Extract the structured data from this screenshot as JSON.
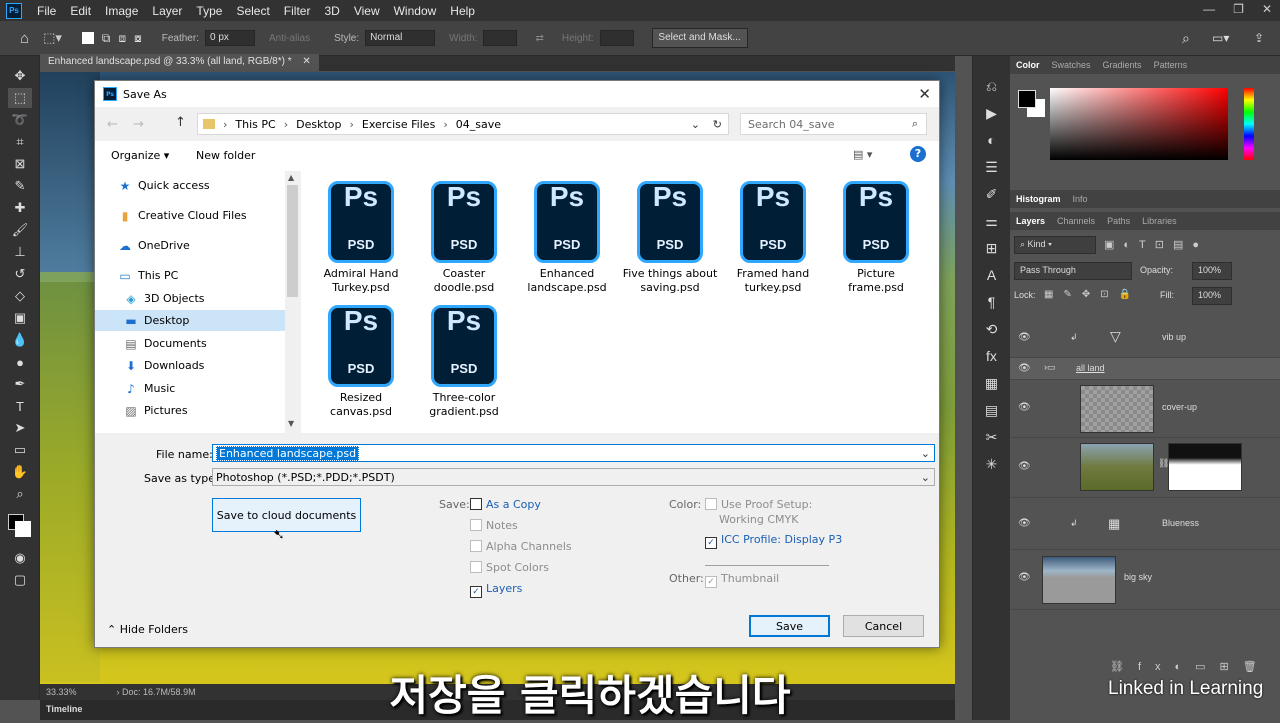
{
  "menubar": {
    "items": [
      "File",
      "Edit",
      "Image",
      "Layer",
      "Type",
      "Select",
      "Filter",
      "3D",
      "View",
      "Window",
      "Help"
    ]
  },
  "options": {
    "feather_label": "Feather:",
    "feather_value": "0 px",
    "antialias_label": "Anti-alias",
    "style_label": "Style:",
    "style_value": "Normal",
    "width_label": "Width:",
    "height_label": "Height:",
    "select_mask": "Select and Mask..."
  },
  "document": {
    "tab_title": "Enhanced landscape.psd @ 33.3% (all land, RGB/8*) *",
    "zoom": "33.33%",
    "doc_info": "Doc: 16.7M/58.9M",
    "timeline": "Timeline"
  },
  "color_panel": {
    "tabs": [
      "Color",
      "Swatches",
      "Gradients",
      "Patterns"
    ]
  },
  "histogram_panel": {
    "tabs": [
      "Histogram",
      "Info"
    ]
  },
  "layers_panel": {
    "tabs": [
      "Layers",
      "Channels",
      "Paths",
      "Libraries"
    ],
    "kind": "Kind",
    "blend": "Pass Through",
    "opacity_label": "Opacity:",
    "opacity": "100%",
    "lock_label": "Lock:",
    "fill_label": "Fill:",
    "fill": "100%",
    "layers": [
      "vib up",
      "all land",
      "cover-up",
      "",
      "Blueness",
      "big sky"
    ]
  },
  "dialog": {
    "title": "Save As",
    "breadcrumb": [
      "This PC",
      "Desktop",
      "Exercise Files",
      "04_save"
    ],
    "search_placeholder": "Search 04_save",
    "organize": "Organize",
    "new_folder": "New folder",
    "nav": [
      "Quick access",
      "Creative Cloud Files",
      "OneDrive",
      "This PC",
      "3D Objects",
      "Desktop",
      "Documents",
      "Downloads",
      "Music",
      "Pictures"
    ],
    "files": [
      {
        "line1": "Admiral Hand",
        "line2": "Turkey.psd"
      },
      {
        "line1": "Coaster",
        "line2": "doodle.psd"
      },
      {
        "line1": "Enhanced",
        "line2": "landscape.psd"
      },
      {
        "line1": "Five things about",
        "line2": "saving.psd"
      },
      {
        "line1": "Framed hand",
        "line2": "turkey.psd"
      },
      {
        "line1": "Picture",
        "line2": "frame.psd"
      },
      {
        "line1": "Resized",
        "line2": "canvas.psd"
      },
      {
        "line1": "Three-color",
        "line2": "gradient.psd"
      }
    ],
    "file_icon_big": "Ps",
    "file_icon_small": "PSD",
    "filename_label": "File name:",
    "filename_value": "Enhanced landscape.psd",
    "savetype_label": "Save as type:",
    "savetype_value": "Photoshop (*.PSD;*.PDD;*.PSDT)",
    "cloud_button": "Save to cloud documents",
    "save_label": "Save:",
    "as_copy": "As a Copy",
    "notes": "Notes",
    "alpha": "Alpha Channels",
    "spot": "Spot Colors",
    "layers": "Layers",
    "color_label": "Color:",
    "proof_line1": "Use Proof Setup:",
    "proof_line2": "Working CMYK",
    "icc_label": "ICC Profile:",
    "icc_value": "Display P3",
    "other_label": "Other:",
    "thumbnail": "Thumbnail",
    "hide_folders": "Hide Folders",
    "save_button": "Save",
    "cancel_button": "Cancel"
  },
  "caption": "저장을 클릭하겠습니다",
  "watermark": "Linked in Learning"
}
